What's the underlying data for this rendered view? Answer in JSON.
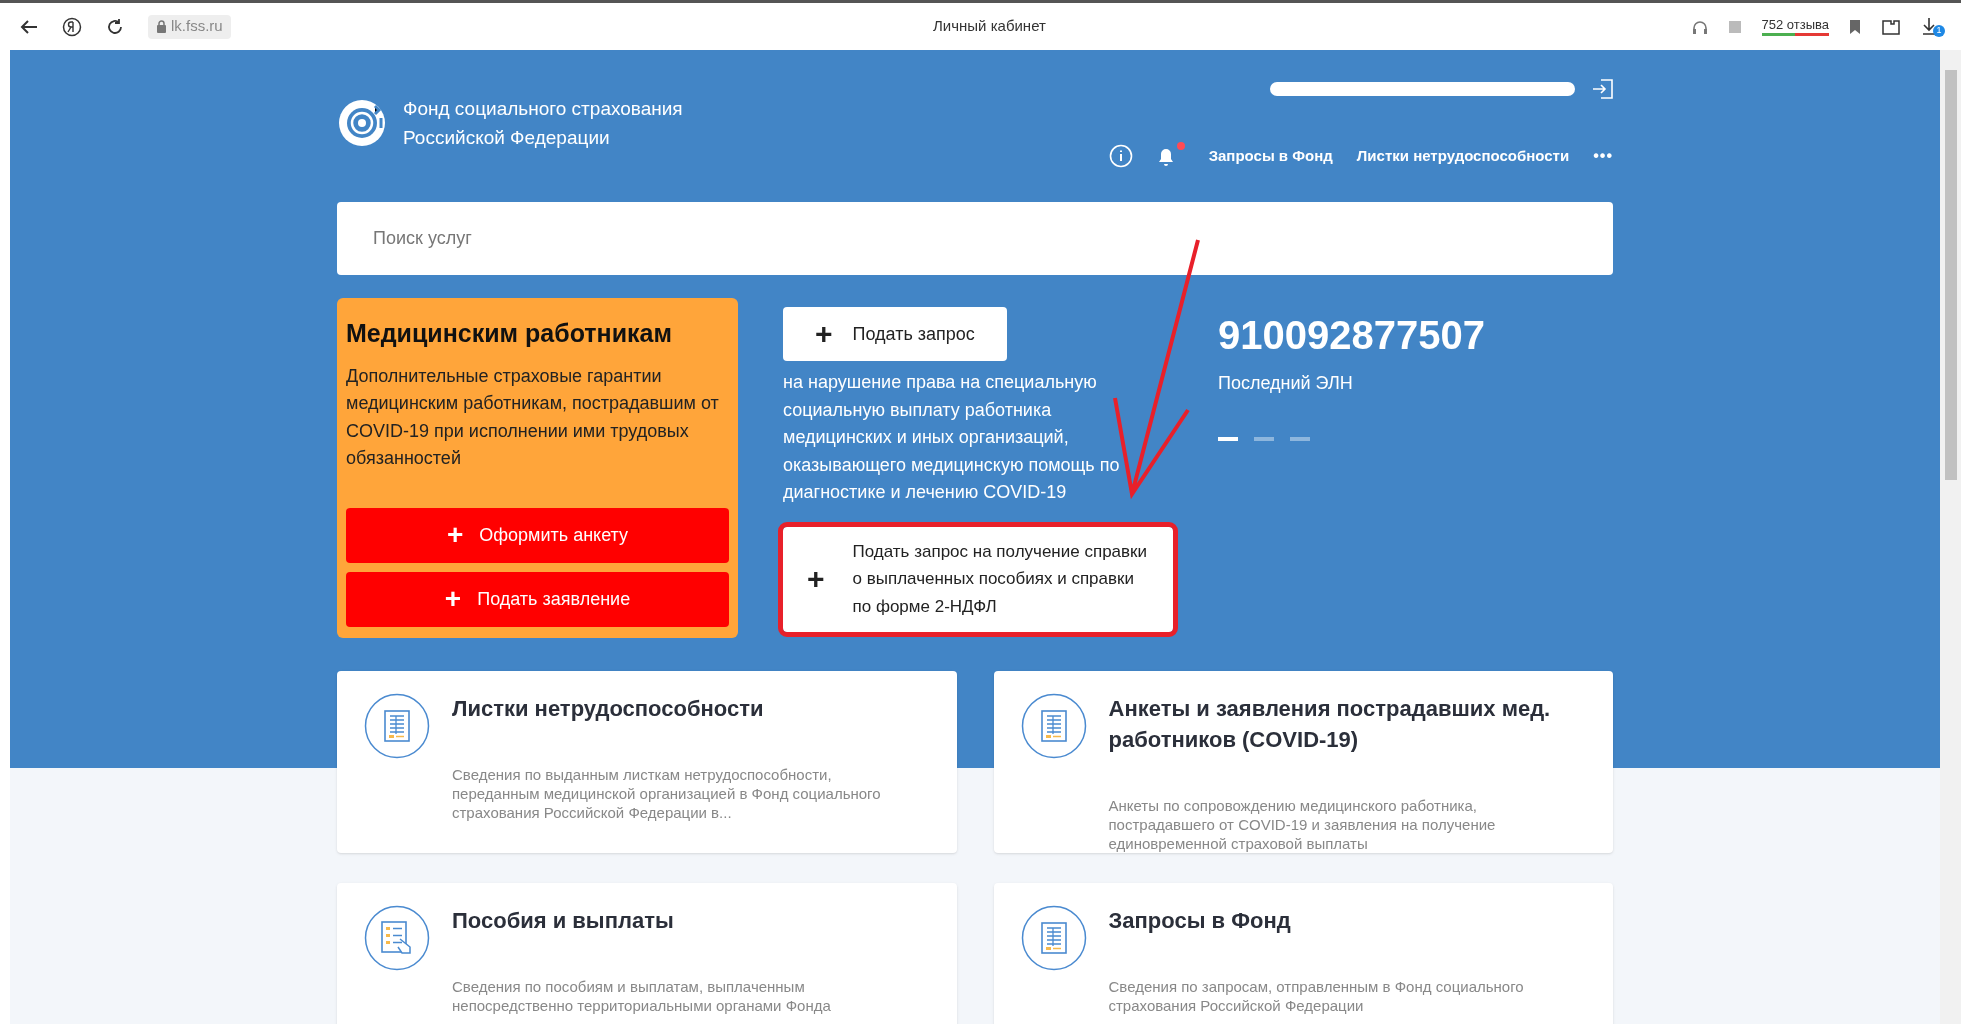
{
  "browser": {
    "url": "lk.fss.ru",
    "title": "Личный кабинет",
    "reviews": "752 отзыва",
    "downloads_badge": "1"
  },
  "header": {
    "org_name": [
      "Фонд социального страхования",
      "Российской Федерации"
    ],
    "notification_unread": true,
    "nav": [
      "Запросы в Фонд",
      "Листки нетрудоспособности"
    ],
    "more": "•••"
  },
  "search": {
    "placeholder": "Поиск услуг"
  },
  "promo": {
    "title": "Медицинским работникам",
    "text": "Дополнительные страховые гарантии медицинским работникам, пострадавшим от COVID-19 при исполнении ими трудовых обязанностей",
    "buttons": [
      {
        "icon": "+",
        "label": "Оформить анкету"
      },
      {
        "icon": "+",
        "label": "Подать заявление"
      }
    ]
  },
  "request": {
    "button": {
      "icon": "+",
      "label": "Подать запрос"
    },
    "text": "на нарушение права на специальную социальную выплату работника медицинских и иных организаций, оказывающего медицинскую помощь по диагностике и лечению COVID-19",
    "certificate_button": {
      "icon": "+",
      "label": "Подать запрос на получение справки о выплаченных пособиях и справки по форме 2-НДФЛ"
    }
  },
  "eln": {
    "number": "910092877507",
    "label": "Последний ЭЛН",
    "pager": [
      {
        "selected": true
      },
      {
        "selected": false
      },
      {
        "selected": false
      }
    ]
  },
  "services": [
    {
      "kind": "document",
      "title": "Листки нетрудоспособности",
      "description": "Сведения по выданным листкам нетрудоспособности, переданным медицинской организацией в Фонд социального страхования Российской Федерации в..."
    },
    {
      "kind": "document",
      "title": "Анкеты и заявления пострадавших мед. работников (COVID-19)",
      "description": "Анкеты по сопровождению медицинского работника, пострадавшего от COVID-19 и заявления на получение единовременной страховой выплаты"
    },
    {
      "kind": "hand-document",
      "title": "Пособия и выплаты",
      "description": "Сведения по пособиям и выплатам, выплаченным непосредственно территориальными органами Фонда"
    },
    {
      "kind": "document",
      "title": "Запросы в Фонд",
      "description": "Сведения по запросам, отправленным в Фонд социального страхования Российской Федерации"
    }
  ]
}
